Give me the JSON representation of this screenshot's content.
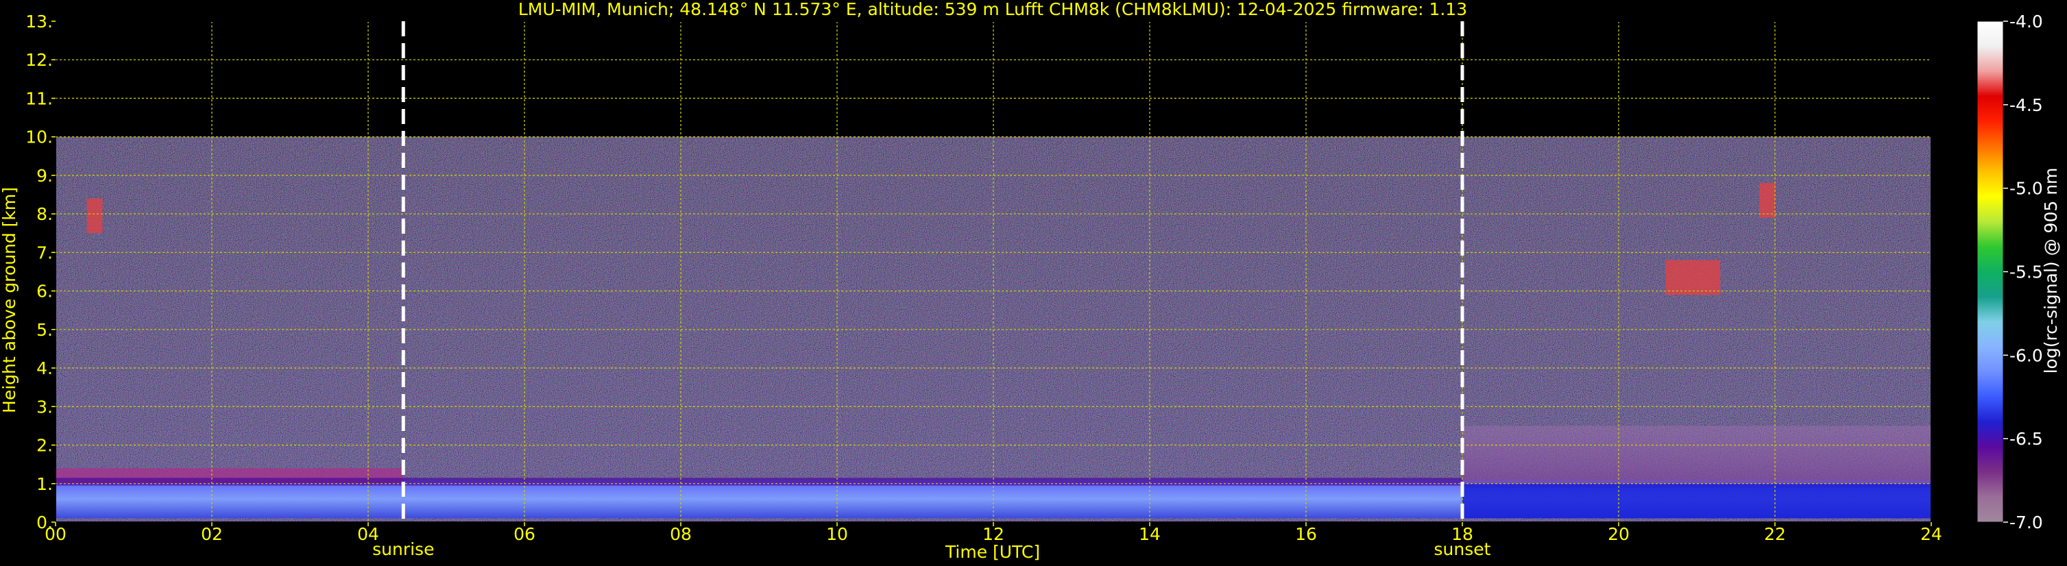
{
  "title": "LMU-MIM, Munich; 48.148° N 11.573° E, altitude: 539 m    Lufft CHM8k (CHM8kLMU): 12-04-2025    firmware: 1.13",
  "colors": {
    "text": "#ffff00",
    "grid": "#cccc00",
    "background": "#000000",
    "marker": "#ffffff"
  },
  "chart_data": {
    "type": "heatmap",
    "title": "LMU-MIM, Munich; 48.148° N 11.573° E, altitude: 539 m    Lufft CHM8k (CHM8kLMU): 12-04-2025    firmware: 1.13",
    "xlabel": "Time [UTC]",
    "ylabel": "Height above ground [km]",
    "xlim": [
      0,
      24
    ],
    "ylim": [
      0,
      13
    ],
    "xticks": [
      "00",
      "02",
      "04",
      "06",
      "08",
      "10",
      "12",
      "14",
      "16",
      "18",
      "20",
      "22",
      "24"
    ],
    "yticks": [
      "0.",
      "1.",
      "2.",
      "3.",
      "4.",
      "5.",
      "6.",
      "7.",
      "8.",
      "9.",
      "10.",
      "11.",
      "12.",
      "13."
    ],
    "grid": true,
    "data_top_km": 10,
    "markers": [
      {
        "label": "sunrise",
        "time": 4.45
      },
      {
        "label": "sunset",
        "time": 18.0
      }
    ],
    "colorbar": {
      "label": "log(rc-signal) @ 905 nm",
      "range": [
        -7.0,
        -4.0
      ],
      "ticks": [
        "-4.0",
        "-4.5",
        "-5.0",
        "-5.5",
        "-6.0",
        "-6.5",
        "-7.0"
      ],
      "stops": [
        "#a0889c",
        "#9a6e9a",
        "#7a2f86",
        "#5a0aa0",
        "#2020d0",
        "#3a5cff",
        "#7090ff",
        "#88b4ff",
        "#7ecfe6",
        "#16a08c",
        "#10b060",
        "#30c830",
        "#b8e838",
        "#ffff00",
        "#ffc000",
        "#ff7000",
        "#ff2000",
        "#e00000",
        "#f0a0a0",
        "#f0f0f0",
        "#ffffff"
      ]
    },
    "features": [
      {
        "kind": "boundary layer",
        "time_range": [
          0,
          24
        ],
        "height_km": [
          0.1,
          1.1
        ]
      },
      {
        "kind": "aerosol layer",
        "time_range": [
          0,
          4.45
        ],
        "height_km": [
          1.0,
          1.4
        ]
      },
      {
        "kind": "evening residual layer",
        "time_range": [
          18,
          24
        ],
        "height_km": [
          0.9,
          2.5
        ]
      },
      {
        "kind": "cirrus",
        "time_range": [
          0.4,
          0.6
        ],
        "height_km": [
          7.5,
          8.4
        ]
      },
      {
        "kind": "cirrus",
        "time_range": [
          20.6,
          21.3
        ],
        "height_km": [
          5.9,
          6.8
        ]
      },
      {
        "kind": "cirrus",
        "time_range": [
          21.8,
          22.0
        ],
        "height_km": [
          7.9,
          8.8
        ]
      }
    ]
  }
}
